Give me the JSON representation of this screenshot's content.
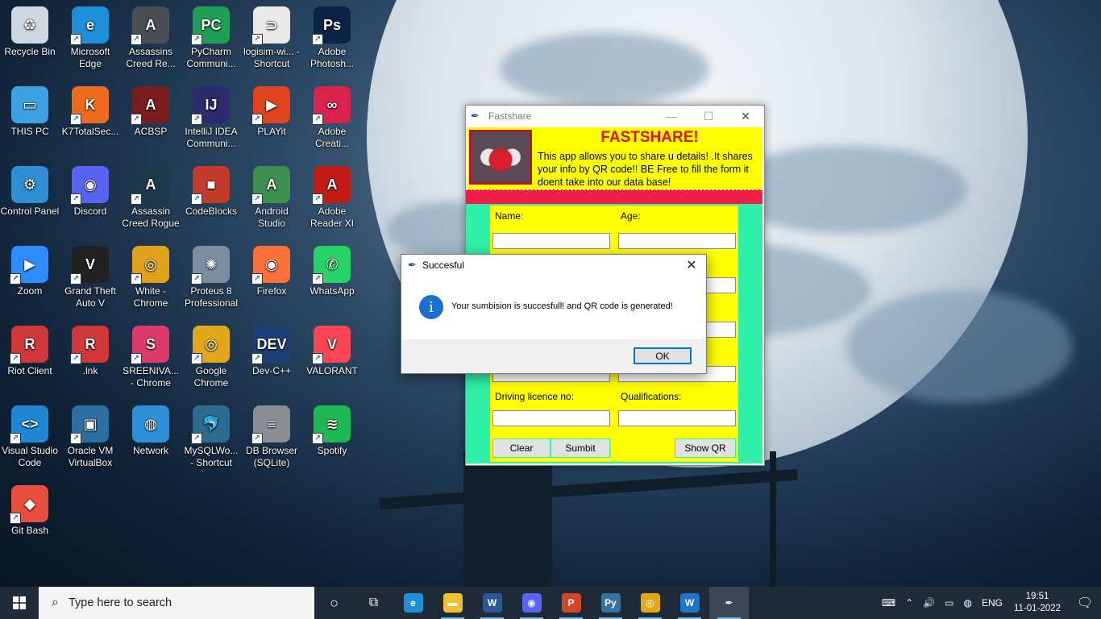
{
  "desktop": {
    "icons": [
      {
        "label": "Recycle Bin",
        "icon": "recycle-bin-icon",
        "color": "#cfd8e0",
        "glyph": "♻"
      },
      {
        "label": "Microsoft Edge",
        "icon": "edge-icon",
        "color": "#1c8fd8",
        "glyph": "e"
      },
      {
        "label": "Assassins Creed Re...",
        "icon": "assassins-creed-icon",
        "color": "#4a4f55",
        "glyph": "A"
      },
      {
        "label": "PyCharm Communi...",
        "icon": "pycharm-icon",
        "color": "#1e9f55",
        "glyph": "PC"
      },
      {
        "label": "logisim-wi... - Shortcut",
        "icon": "logisim-icon",
        "color": "#e9e9e9",
        "glyph": "⊃"
      },
      {
        "label": "Adobe Photosh...",
        "icon": "photoshop-icon",
        "color": "#0b2445",
        "glyph": "Ps"
      },
      {
        "label": "THIS PC",
        "icon": "this-pc-icon",
        "color": "#3ba1e3",
        "glyph": "▭"
      },
      {
        "label": "K7TotalSec...",
        "icon": "k7-icon",
        "color": "#ef6a1c",
        "glyph": "K"
      },
      {
        "label": "ACBSP",
        "icon": "acbsp-icon",
        "color": "#7a1d1d",
        "glyph": "A"
      },
      {
        "label": "IntelliJ IDEA Communi...",
        "icon": "intellij-icon",
        "color": "#2b2b6e",
        "glyph": "IJ"
      },
      {
        "label": "PLAYit",
        "icon": "playit-icon",
        "color": "#e0451f",
        "glyph": "▶"
      },
      {
        "label": "Adobe Creati...",
        "icon": "creative-cloud-icon",
        "color": "#d9234b",
        "glyph": "∞"
      },
      {
        "label": "Control Panel",
        "icon": "control-panel-icon",
        "color": "#2f8fd2",
        "glyph": "⚙"
      },
      {
        "label": "Discord",
        "icon": "discord-icon",
        "color": "#5865f2",
        "glyph": "◉"
      },
      {
        "label": "Assassin Creed Rogue",
        "icon": "ac-rogue-icon",
        "color": "#1d3a4d",
        "glyph": "A"
      },
      {
        "label": "CodeBlocks",
        "icon": "codeblocks-icon",
        "color": "#c33b2a",
        "glyph": "■"
      },
      {
        "label": "Android Studio",
        "icon": "android-studio-icon",
        "color": "#3d8f4f",
        "glyph": "A"
      },
      {
        "label": "Adobe Reader XI",
        "icon": "adobe-reader-icon",
        "color": "#c21b14",
        "glyph": "A"
      },
      {
        "label": "Zoom",
        "icon": "zoom-icon",
        "color": "#2d8cff",
        "glyph": "▶"
      },
      {
        "label": "Grand Theft Auto V",
        "icon": "gta-icon",
        "color": "#222",
        "glyph": "V"
      },
      {
        "label": "White - Chrome",
        "icon": "chrome-white-icon",
        "color": "#e0a21a",
        "glyph": "◎"
      },
      {
        "label": "Proteus 8 Professional",
        "icon": "proteus-icon",
        "color": "#7c8fa0",
        "glyph": "✺"
      },
      {
        "label": "Firefox",
        "icon": "firefox-icon",
        "color": "#ff7139",
        "glyph": "◉"
      },
      {
        "label": "WhatsApp",
        "icon": "whatsapp-icon",
        "color": "#25d366",
        "glyph": "✆"
      },
      {
        "label": "Riot Client",
        "icon": "riot-client-icon",
        "color": "#d13639",
        "glyph": "R"
      },
      {
        "label": ".lnk",
        "icon": "riot-lnk-icon",
        "color": "#d13639",
        "glyph": "R"
      },
      {
        "label": "SREENIVA... - Chrome",
        "icon": "chrome-profile-icon",
        "color": "#de3a6c",
        "glyph": "S"
      },
      {
        "label": "Google Chrome",
        "icon": "chrome-icon",
        "color": "#e1a81a",
        "glyph": "◎"
      },
      {
        "label": "Dev-C++",
        "icon": "devcpp-icon",
        "color": "#1e3f77",
        "glyph": "DEV"
      },
      {
        "label": "VALORANT",
        "icon": "valorant-icon",
        "color": "#fd4556",
        "glyph": "V"
      },
      {
        "label": "Visual Studio Code",
        "icon": "vscode-icon",
        "color": "#1e88d6",
        "glyph": "<>"
      },
      {
        "label": "Oracle VM VirtualBox",
        "icon": "virtualbox-icon",
        "color": "#2d6ea3",
        "glyph": "▣"
      },
      {
        "label": "Network",
        "icon": "network-icon",
        "color": "#2f90d8",
        "glyph": "◍"
      },
      {
        "label": "MySQLWo... - Shortcut",
        "icon": "mysql-workbench-icon",
        "color": "#2e6c8f",
        "glyph": "🐬"
      },
      {
        "label": "DB Browser (SQLite)",
        "icon": "db-browser-icon",
        "color": "#8a8f96",
        "glyph": "≡"
      },
      {
        "label": "Spotify",
        "icon": "spotify-icon",
        "color": "#1db954",
        "glyph": "≋"
      },
      {
        "label": "Git Bash",
        "icon": "git-bash-icon",
        "color": "#e84d3d",
        "glyph": "◆"
      }
    ]
  },
  "fastshare": {
    "window_title": "Fastshare",
    "heading": "FASTSHARE!",
    "description": "This app allows you to share u details! .It shares your info by QR code!! BE Free to fill the form it doent take into our data base!",
    "labels": {
      "name": "Name:",
      "age": "Age:",
      "driving_licence": "Driving licence no:",
      "qualifications": "Qualifications:"
    },
    "buttons": {
      "clear": "Clear",
      "submit": "Sumbit",
      "show_qr": "Show QR"
    }
  },
  "dialog": {
    "title": "Succesful",
    "message": "Your sumbision is succesfull! and QR code is generated!",
    "ok": "OK"
  },
  "taskbar": {
    "search_placeholder": "Type here to search",
    "apps": [
      {
        "icon": "edge-icon",
        "color": "#1c8fd8",
        "glyph": "e"
      },
      {
        "icon": "file-explorer-icon",
        "color": "#f0c030",
        "glyph": "▬"
      },
      {
        "icon": "word-icon",
        "color": "#2b579a",
        "glyph": "W"
      },
      {
        "icon": "discord-icon",
        "color": "#5865f2",
        "glyph": "◉"
      },
      {
        "icon": "powerpoint-icon",
        "color": "#d24726",
        "glyph": "P"
      },
      {
        "icon": "python-icon",
        "color": "#3572a5",
        "glyph": "Py"
      },
      {
        "icon": "chrome-icon",
        "color": "#e1a81a",
        "glyph": "◎"
      },
      {
        "icon": "whatsapp-web-icon",
        "color": "#1d75c9",
        "glyph": "W"
      },
      {
        "icon": "feather-icon",
        "color": "#3b4757",
        "glyph": "✒"
      }
    ],
    "language": "ENG",
    "time": "19:51",
    "date": "11-01-2022"
  }
}
